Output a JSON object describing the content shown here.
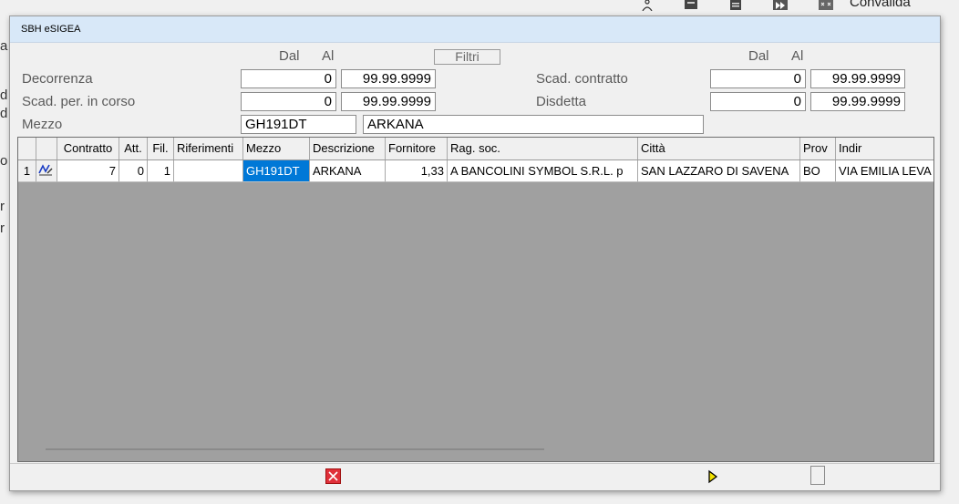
{
  "background": {
    "toolbar_label": "Convalida",
    "left_letters": [
      "a",
      "d",
      "d",
      "o",
      "r",
      "r"
    ]
  },
  "dialog": {
    "title": "SBH eSIGEA",
    "filtri_label": "Filtri",
    "dal_label": "Dal",
    "al_label": "Al",
    "filters": {
      "decorrenza": {
        "label": "Decorrenza",
        "dal": "0",
        "al": "99.99.9999"
      },
      "scad_per_in_corso": {
        "label": "Scad. per. in corso",
        "dal": "0",
        "al": "99.99.9999"
      },
      "mezzo": {
        "label": "Mezzo",
        "code": "GH191DT",
        "description": "ARKANA"
      },
      "scad_contratto": {
        "label": "Scad. contratto",
        "dal": "0",
        "al": "99.99.9999"
      },
      "disdetta": {
        "label": "Disdetta",
        "dal": "0",
        "al": "99.99.9999"
      }
    }
  },
  "grid": {
    "columns": [
      "",
      "",
      "Contratto",
      "Att.",
      "Fil.",
      "Riferimenti",
      "Mezzo",
      "Descrizione",
      "Fornitore",
      "Rag. soc.",
      "Città",
      "Prov",
      "Indir"
    ],
    "rows": [
      {
        "index": "1",
        "contratto": "7",
        "att": "0",
        "fil": "1",
        "riferimenti": "",
        "mezzo": "GH191DT",
        "descrizione": "ARKANA",
        "fornitore": "1,33",
        "rag_soc": "A BANCOLINI SYMBOL S.R.L. p",
        "citta": "SAN LAZZARO DI SAVENA",
        "prov": "BO",
        "indir": "VIA EMILIA LEVA"
      }
    ]
  },
  "icons": [
    "person-icon",
    "print-icon",
    "document-icon",
    "fast-forward-icon",
    "grid-icon",
    "edit-pencil-icon",
    "cancel-icon",
    "next-arrow-icon"
  ]
}
